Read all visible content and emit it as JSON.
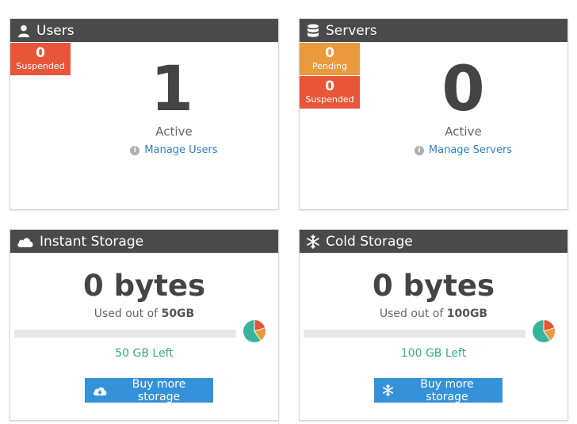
{
  "users": {
    "title": "Users",
    "icon": "user-icon",
    "badges": [
      {
        "count": "0",
        "label": "Suspended",
        "color": "#e8563a"
      }
    ],
    "count": "1",
    "status": "Active",
    "link": "Manage Users"
  },
  "servers": {
    "title": "Servers",
    "icon": "database-icon",
    "badges": [
      {
        "count": "0",
        "label": "Pending",
        "color": "#e99a3c"
      },
      {
        "count": "0",
        "label": "Suspended",
        "color": "#e8563a"
      }
    ],
    "count": "0",
    "status": "Active",
    "link": "Manage Servers"
  },
  "instant": {
    "title": "Instant Storage",
    "icon": "cloud-icon",
    "amount": "0 bytes",
    "used_prefix": "Used out of",
    "capacity": "50GB",
    "usage_fraction": 0,
    "left": "50 GB Left",
    "button": "Buy more storage",
    "button_icon": "cloud-download-icon"
  },
  "cold": {
    "title": "Cold Storage",
    "icon": "snowflake-icon",
    "amount": "0 bytes",
    "used_prefix": "Used out of",
    "capacity": "100GB",
    "usage_fraction": 0,
    "left": "100 GB Left",
    "button": "Buy more storage",
    "button_icon": "snowflake-icon"
  },
  "colors": {
    "header": "#4a4a4a",
    "link": "#2f7fc0",
    "button": "#3592d8",
    "left_text": "#3aa88f",
    "pie": [
      "#38b49a",
      "#e8563a",
      "#e99a3c"
    ]
  }
}
